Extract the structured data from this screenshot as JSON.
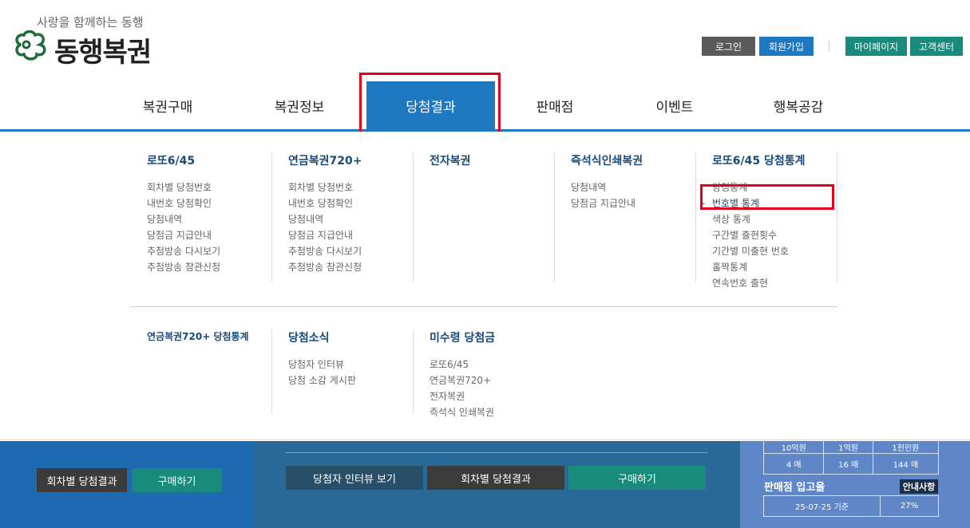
{
  "header": {
    "slogan": "사랑을 함께하는 동행",
    "logo_name": "동행복권",
    "util": {
      "login": "로그인",
      "join": "회원가입",
      "mypage": "마이페이지",
      "cs": "고객센터"
    }
  },
  "gnb": {
    "items": [
      {
        "label": "복권구매"
      },
      {
        "label": "복권정보"
      },
      {
        "label": "당첨결과",
        "active": true
      },
      {
        "label": "판매점"
      },
      {
        "label": "이벤트"
      },
      {
        "label": "행복공감"
      }
    ]
  },
  "dropdown": {
    "columns": [
      {
        "title": "로또6/45",
        "links": [
          "회차별 당첨번호",
          "내번호 당첨확인",
          "당첨내역",
          "당첨금 지급안내",
          "추첨방송 다시보기",
          "추첨방송 참관신청"
        ]
      },
      {
        "title": "연금복권720+",
        "links": [
          "회차별 당첨번호",
          "내번호 당첨확인",
          "당첨내역",
          "당첨금 지급안내",
          "추첨방송 다시보기",
          "추첨방송 참관신청"
        ]
      },
      {
        "title": "전자복권",
        "links": []
      },
      {
        "title": "즉석식인쇄복권",
        "links": [
          "당첨내역",
          "당첨금 지급안내"
        ]
      },
      {
        "title": "로또6/45 당첨통계",
        "links": [
          "당첨통계",
          "번호별 통계",
          "색상 통계",
          "구간별 출현횟수",
          "기간별 미출현 번호",
          "홀짝통계",
          "연속번호 출현"
        ],
        "active_index": 1
      }
    ],
    "row2": [
      {
        "title": "연금복권720+ 당첨통계",
        "links": []
      },
      {
        "title": "당첨소식",
        "links": [
          "당첨자 인터뷰",
          "당첨 소감 게시판"
        ]
      },
      {
        "title": "미수령 당첨금",
        "links": [
          "로또6/45",
          "연금복권720+",
          "전자복권",
          "즉석식 인쇄복권"
        ]
      }
    ]
  },
  "background": {
    "left_buttons": [
      "회차별 당첨결과",
      "구매하기"
    ],
    "center_buttons": [
      "당첨자 인터뷰 보기",
      "회차별 당첨결과",
      "구매하기"
    ],
    "prize_table": {
      "header": [
        "10억원",
        "1억원",
        "1천만원"
      ],
      "counts": [
        "4 매",
        "16 매",
        "144 매"
      ]
    },
    "sale_label": "판매점 입고율",
    "notice_badge": "안내사항",
    "sale_table": {
      "date": "25-07-25 기준",
      "rate": "27%"
    }
  },
  "colors": {
    "primary_blue": "#1d78bf",
    "teal": "#188b7d",
    "highlight_red": "#e0001b",
    "title_navy": "#1a4a7a"
  }
}
